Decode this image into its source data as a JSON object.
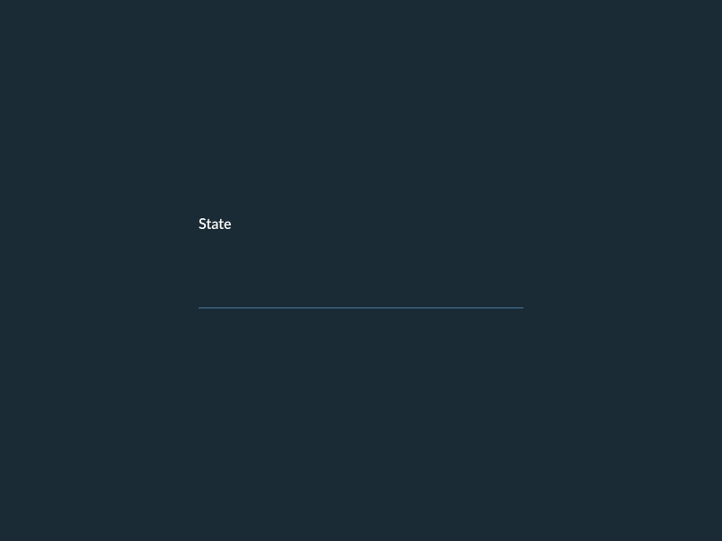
{
  "form": {
    "state": {
      "label": "State",
      "value": "",
      "placeholder": ""
    }
  },
  "colors": {
    "background": "#1a2b36",
    "label_text": "#ffffff",
    "input_border": "#4a7a9c"
  }
}
